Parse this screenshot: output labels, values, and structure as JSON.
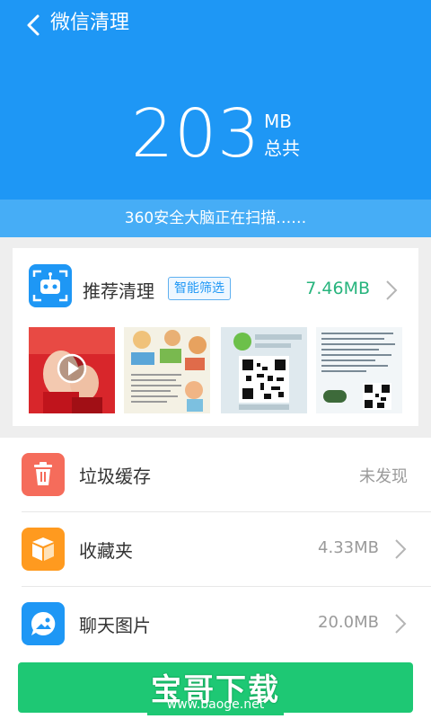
{
  "header": {
    "title": "微信清理",
    "total_size": "203",
    "unit": "MB",
    "total_label": "总共",
    "scan_status": "360安全大脑正在扫描……"
  },
  "recommend": {
    "title": "推荐清理",
    "badge": "智能筛选",
    "size": "7.46MB"
  },
  "list": [
    {
      "label": "垃圾缓存",
      "value": "未发现",
      "icon": "trash-icon",
      "color": "#f56c5b"
    },
    {
      "label": "收藏夹",
      "value": "4.33MB",
      "icon": "box-icon",
      "color": "#ff9a1f"
    },
    {
      "label": "聊天图片",
      "value": "20.0MB",
      "icon": "image-chat-icon",
      "color": "#1e97f5"
    }
  ],
  "watermark": {
    "main": "宝哥下载",
    "url": "www.baoge.net"
  },
  "colors": {
    "header": "#1e97f5",
    "accent_green": "#27b47d",
    "action": "#1ec874"
  }
}
